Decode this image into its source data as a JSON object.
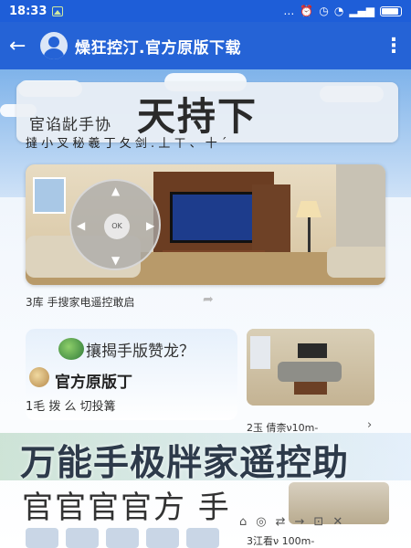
{
  "status_bar": {
    "time": "18:33",
    "icons": [
      "dots",
      "alarm",
      "clock",
      "wifi",
      "signal",
      "battery"
    ]
  },
  "app_bar": {
    "back_icon": "←",
    "title": "燥狂控汀.官方原版下载",
    "more_icon": "⋮"
  },
  "banner": {
    "small_text": "宦谄龀手协",
    "big_text": "天持下"
  },
  "subtitle": "撻 小 叉 秘 羲 丁 夂 剑 . 丄 ㄒ 、 十 ˊ",
  "card1": {
    "caption": "3库 手搜家电遥控敢启"
  },
  "card2": {
    "title": "攘揭手版赞龙？",
    "subtitle": "官方原版丁",
    "meta": "1毛 拨 么 切投篝"
  },
  "card3": {
    "meta": "2玉 倩柰ν10m-"
  },
  "slogan": "万能手极牉家遥控助",
  "official_row": "官官官官方 手",
  "bottom_meta": "3江看ν 100m-",
  "colors": {
    "appbar": "#2563d6",
    "statusbar": "#1e5ed8"
  }
}
